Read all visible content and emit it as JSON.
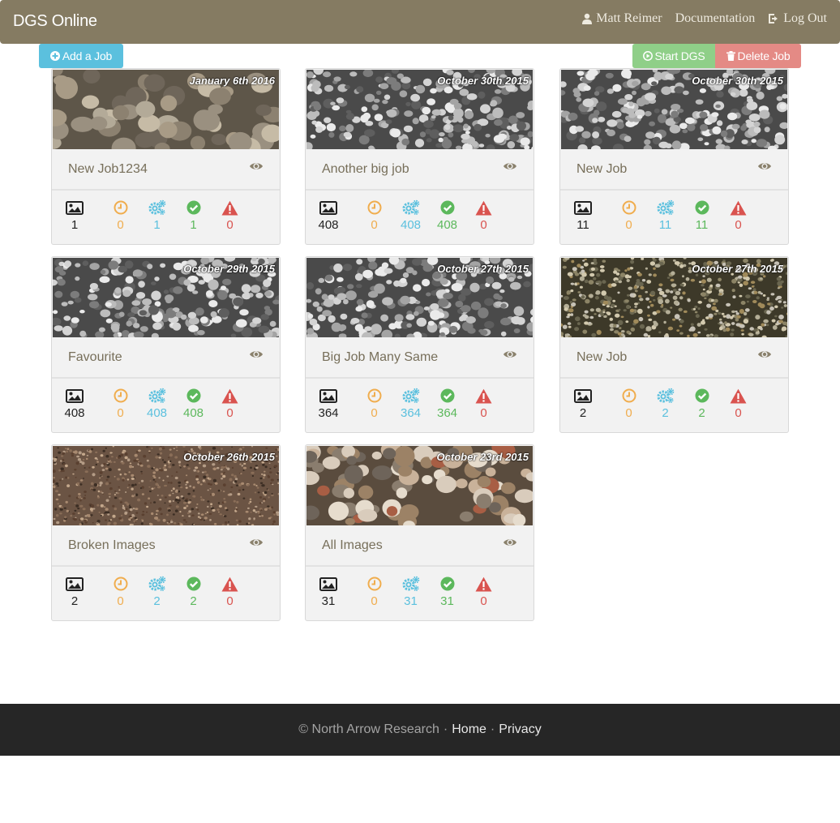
{
  "navbar": {
    "brand": "DGS Online",
    "user": "Matt Reimer",
    "documentation": "Documentation",
    "logout": "Log Out"
  },
  "toolbar": {
    "add_job": "Add a Job",
    "start_dgs": "Start DGS",
    "delete_job": "Delete Job"
  },
  "jobs": [
    {
      "date": "January 6th 2016",
      "title": "New Job1234",
      "texture": "pebbles",
      "images": "1",
      "pending": "0",
      "processing": "1",
      "complete": "1",
      "errors": "0"
    },
    {
      "date": "October 30th 2015",
      "title": "Another big job",
      "texture": "gray",
      "images": "408",
      "pending": "0",
      "processing": "408",
      "complete": "408",
      "errors": "0"
    },
    {
      "date": "October 30th 2015",
      "title": "New Job",
      "texture": "gray",
      "images": "11",
      "pending": "0",
      "processing": "11",
      "complete": "11",
      "errors": "0"
    },
    {
      "date": "October 29th 2015",
      "title": "Favourite",
      "texture": "gray",
      "images": "408",
      "pending": "0",
      "processing": "408",
      "complete": "408",
      "errors": "0"
    },
    {
      "date": "October 27th 2015",
      "title": "Big Job Many Same",
      "texture": "gray",
      "images": "364",
      "pending": "0",
      "processing": "364",
      "complete": "364",
      "errors": "0"
    },
    {
      "date": "October 27th 2015",
      "title": "New Job",
      "texture": "sand",
      "images": "2",
      "pending": "0",
      "processing": "2",
      "complete": "2",
      "errors": "0"
    },
    {
      "date": "October 26th 2015",
      "title": "Broken Images",
      "texture": "fine",
      "images": "2",
      "pending": "0",
      "processing": "2",
      "complete": "2",
      "errors": "0"
    },
    {
      "date": "October 23rd 2015",
      "title": "All Images",
      "texture": "gravel",
      "images": "31",
      "pending": "0",
      "processing": "31",
      "complete": "31",
      "errors": "0"
    }
  ],
  "footer": {
    "copyright": "© North Arrow Research",
    "home": "Home",
    "privacy": "Privacy"
  },
  "colors": {
    "navbar": "#857b62",
    "info": "#5bc0de",
    "success": "#5cb85c",
    "warning": "#f0ad4e",
    "danger": "#d9534f"
  }
}
